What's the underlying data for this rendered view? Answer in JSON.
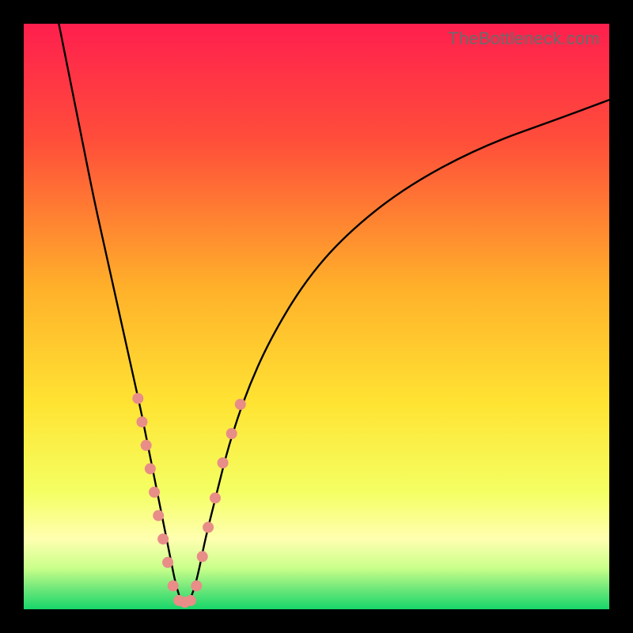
{
  "watermark": "TheBottleneck.com",
  "chart_data": {
    "type": "line",
    "title": "",
    "xlabel": "",
    "ylabel": "",
    "xlim": [
      0,
      100
    ],
    "ylim": [
      0,
      100
    ],
    "grid": false,
    "legend": false,
    "x_optimal": 27,
    "gradient_stops": [
      {
        "pos": 0.0,
        "color": "#ff1f4e"
      },
      {
        "pos": 0.2,
        "color": "#ff4e3a"
      },
      {
        "pos": 0.45,
        "color": "#ffb02a"
      },
      {
        "pos": 0.65,
        "color": "#ffe433"
      },
      {
        "pos": 0.8,
        "color": "#f4ff63"
      },
      {
        "pos": 0.88,
        "color": "#ffffb0"
      },
      {
        "pos": 0.93,
        "color": "#c9ff8a"
      },
      {
        "pos": 0.965,
        "color": "#6fe77a"
      },
      {
        "pos": 1.0,
        "color": "#17d66a"
      }
    ],
    "series": [
      {
        "name": "bottleneck-curve",
        "color": "#000000",
        "x": [
          6,
          8,
          10,
          12,
          14,
          16,
          18,
          20,
          21,
          22,
          23,
          24,
          25,
          26,
          27,
          28,
          29,
          30,
          31,
          33,
          35,
          38,
          42,
          48,
          55,
          65,
          78,
          92,
          100
        ],
        "y": [
          100,
          90,
          80,
          70,
          61,
          52,
          43,
          34,
          29,
          24,
          19,
          14,
          9,
          4,
          1,
          1,
          3,
          7,
          12,
          20,
          28,
          37,
          46,
          56,
          64,
          72,
          79,
          84,
          87
        ]
      }
    ],
    "scatter": {
      "name": "highlight-dots",
      "color": "#e88d87",
      "radius": 7,
      "points": [
        {
          "x": 19.5,
          "y": 36
        },
        {
          "x": 20.2,
          "y": 32
        },
        {
          "x": 20.9,
          "y": 28
        },
        {
          "x": 21.6,
          "y": 24
        },
        {
          "x": 22.3,
          "y": 20
        },
        {
          "x": 23.0,
          "y": 16
        },
        {
          "x": 23.8,
          "y": 12
        },
        {
          "x": 24.6,
          "y": 8
        },
        {
          "x": 25.5,
          "y": 4
        },
        {
          "x": 26.5,
          "y": 1.5
        },
        {
          "x": 27.5,
          "y": 1.2
        },
        {
          "x": 28.5,
          "y": 1.5
        },
        {
          "x": 29.5,
          "y": 4
        },
        {
          "x": 30.5,
          "y": 9
        },
        {
          "x": 31.5,
          "y": 14
        },
        {
          "x": 32.7,
          "y": 19
        },
        {
          "x": 34.0,
          "y": 25
        },
        {
          "x": 35.5,
          "y": 30
        },
        {
          "x": 37.0,
          "y": 35
        }
      ]
    }
  }
}
